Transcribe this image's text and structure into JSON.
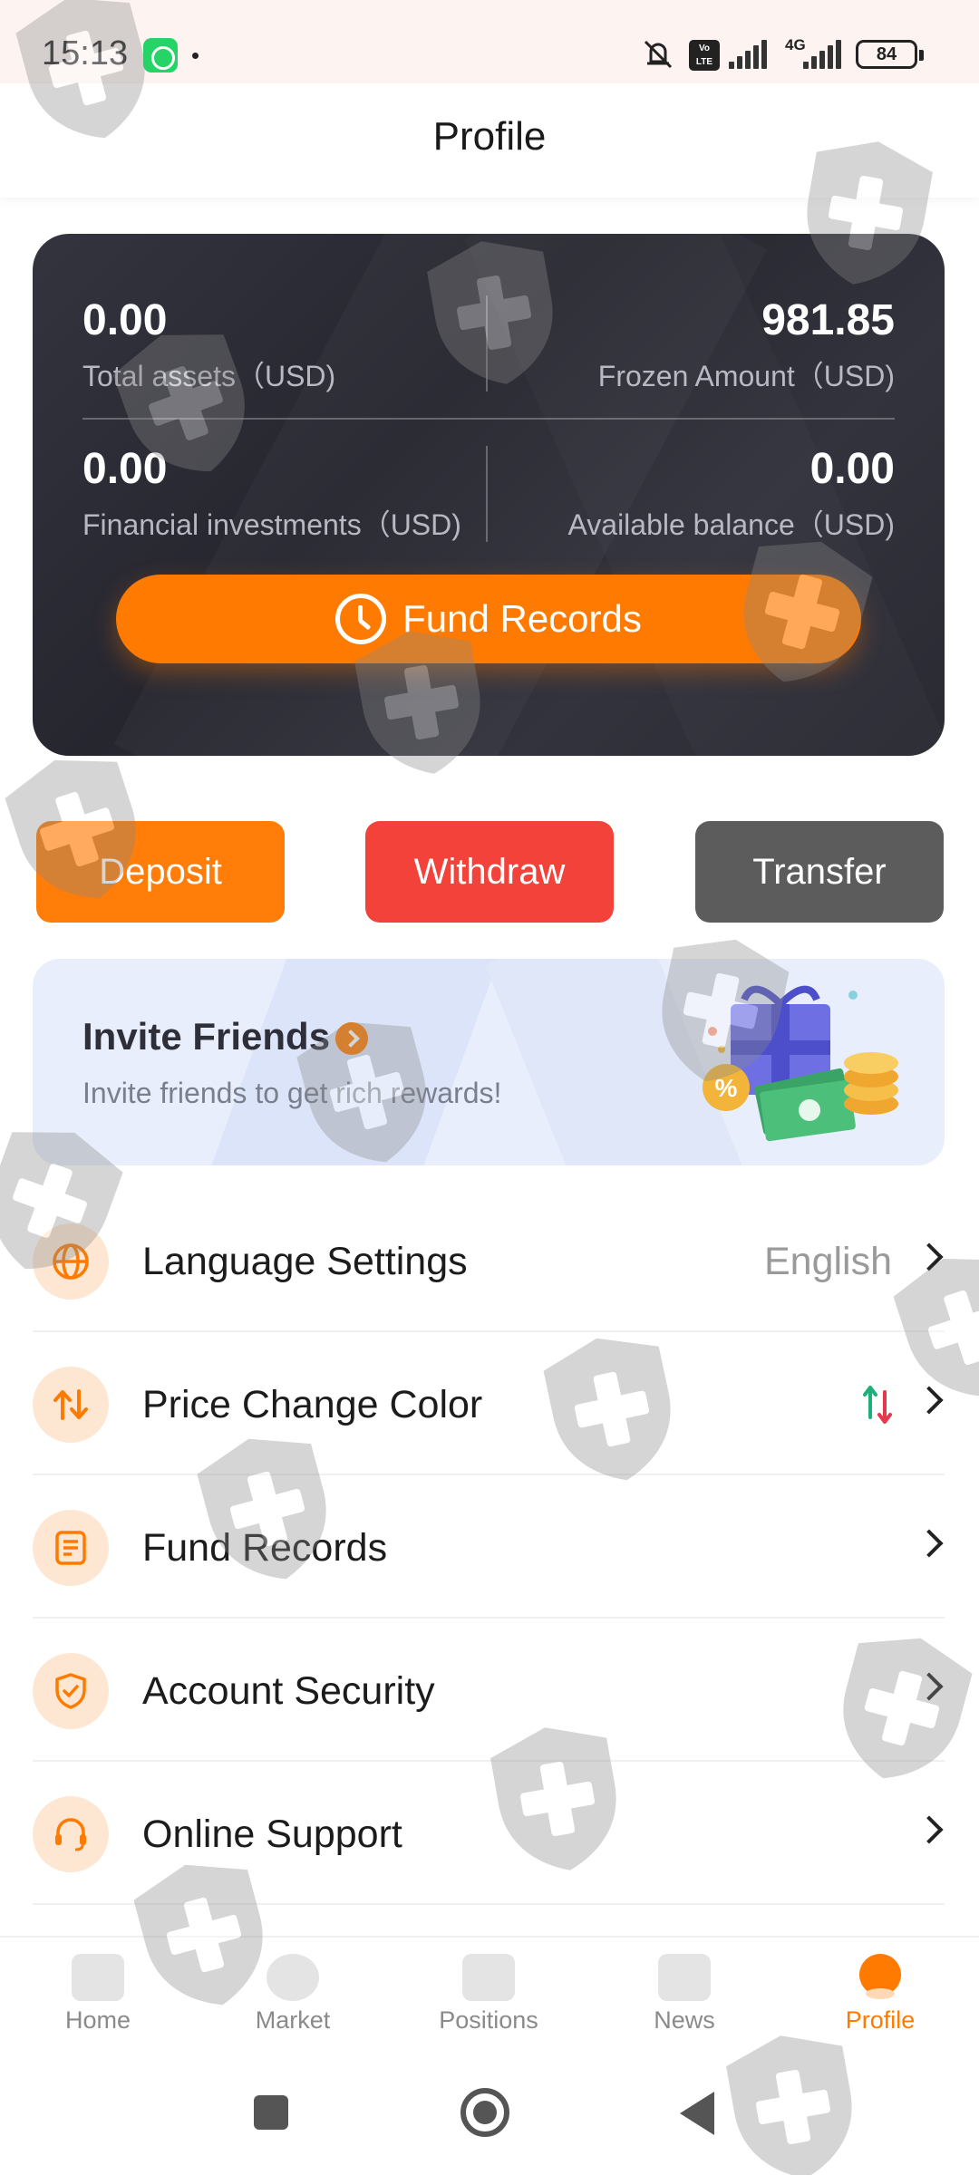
{
  "status_bar": {
    "time": "15:13",
    "icons": [
      "whatsapp-icon",
      "notification-dot-icon",
      "mute-icon",
      "volte-icon",
      "signal-icon",
      "signal-4g-icon"
    ],
    "network": "4G",
    "battery": "84"
  },
  "header": {
    "title": "Profile"
  },
  "assets": {
    "total_assets": {
      "value": "0.00",
      "label": "Total assets（USD)"
    },
    "frozen_amount": {
      "value": "981.85",
      "label": "Frozen Amount（USD)"
    },
    "financial_investments": {
      "value": "0.00",
      "label": "Financial investments（USD)"
    },
    "available_balance": {
      "value": "0.00",
      "label": "Available balance（USD)"
    },
    "fund_records_button": "Fund Records"
  },
  "actions": {
    "deposit": "Deposit",
    "withdraw": "Withdraw",
    "transfer": "Transfer"
  },
  "invite": {
    "title": "Invite Friends",
    "subtitle": "Invite friends to get rich rewards!"
  },
  "menu": [
    {
      "label": "Language Settings",
      "value": "English",
      "icon": "globe-icon"
    },
    {
      "label": "Price Change Color",
      "value": "",
      "icon": "price-change-icon"
    },
    {
      "label": "Fund Records",
      "value": "",
      "icon": "document-icon"
    },
    {
      "label": "Account Security",
      "value": "",
      "icon": "shield-check-icon"
    },
    {
      "label": "Online Support",
      "value": "",
      "icon": "headset-icon"
    }
  ],
  "bottom_nav": [
    {
      "label": "Home",
      "icon": "home-icon"
    },
    {
      "label": "Market",
      "icon": "market-icon"
    },
    {
      "label": "Positions",
      "icon": "positions-icon"
    },
    {
      "label": "News",
      "icon": "news-icon"
    },
    {
      "label": "Profile",
      "icon": "profile-icon",
      "active": true
    }
  ],
  "colors": {
    "accent": "#ff7a00",
    "withdraw": "#f2423a",
    "transfer": "#5c5c5c",
    "card_bg": "#2d2d36",
    "price_up": "#1fb07a",
    "price_down": "#e8374b"
  }
}
